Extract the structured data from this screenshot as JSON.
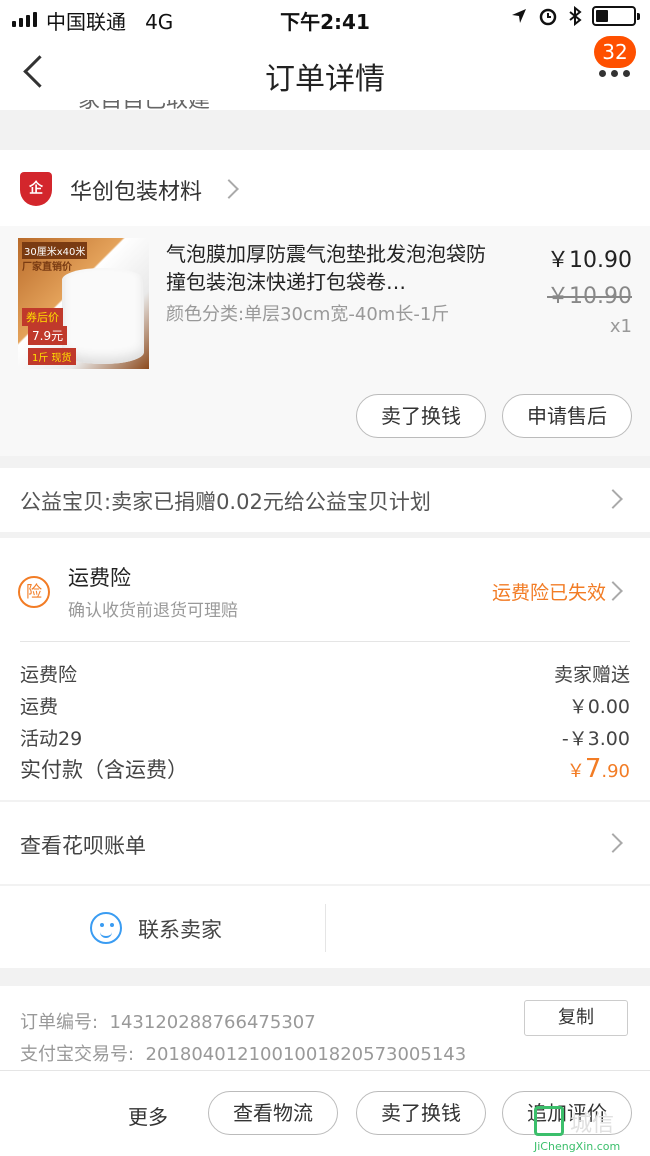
{
  "status_bar": {
    "carrier": "中国联通",
    "network": "4G",
    "time": "下午2:41"
  },
  "nav": {
    "title": "订单详情",
    "badge_count": "32",
    "cut_text": "家自自己取建"
  },
  "shop": {
    "logo_text": "企",
    "name": "华创包装材料"
  },
  "item": {
    "title": "气泡膜加厚防震气泡垫批发泡泡袋防撞包装泡沫快递打包袋卷…",
    "sku": "颜色分类:单层30cm宽-40m长-1斤",
    "price": "￥10.90",
    "original_price": "￥10.90",
    "quantity": "x1",
    "image_texts": [
      "30厘米x40米",
      "厂家直销价",
      "券后价",
      "7.9元",
      "1斤 现货"
    ],
    "buttons": [
      "卖了换钱",
      "申请售后"
    ]
  },
  "charity": {
    "text": "公益宝贝:卖家已捐赠0.02元给公益宝贝计划"
  },
  "insurance": {
    "icon_text": "险",
    "title": "运费险",
    "subtitle": "确认收货前退货可理赔",
    "status": "运费险已失效",
    "status_color": "#f27c25"
  },
  "fees": {
    "rows": [
      {
        "label": "运费险",
        "value": "卖家赠送"
      },
      {
        "label": "运费",
        "value": "￥0.00"
      },
      {
        "label": "活动29",
        "value": "-￥3.00"
      }
    ],
    "total_label": "实付款（含运费）",
    "total_currency": "￥",
    "total_int": "7",
    "total_dec": ".90"
  },
  "huabei": {
    "text": "查看花呗账单"
  },
  "contact": {
    "text": "联系卖家"
  },
  "order_info": {
    "order_no_label": "订单编号:",
    "order_no": "143120288766475307",
    "alipay_label": "支付宝交易号:",
    "alipay_no": "2018040121001001820573005143",
    "copy_label": "复制"
  },
  "bottom_bar": {
    "more": "更多",
    "buttons": [
      "查看物流",
      "卖了换钱",
      "追加评价"
    ]
  },
  "watermark": {
    "cn": "城信",
    "en": "JiChengXin.com"
  }
}
